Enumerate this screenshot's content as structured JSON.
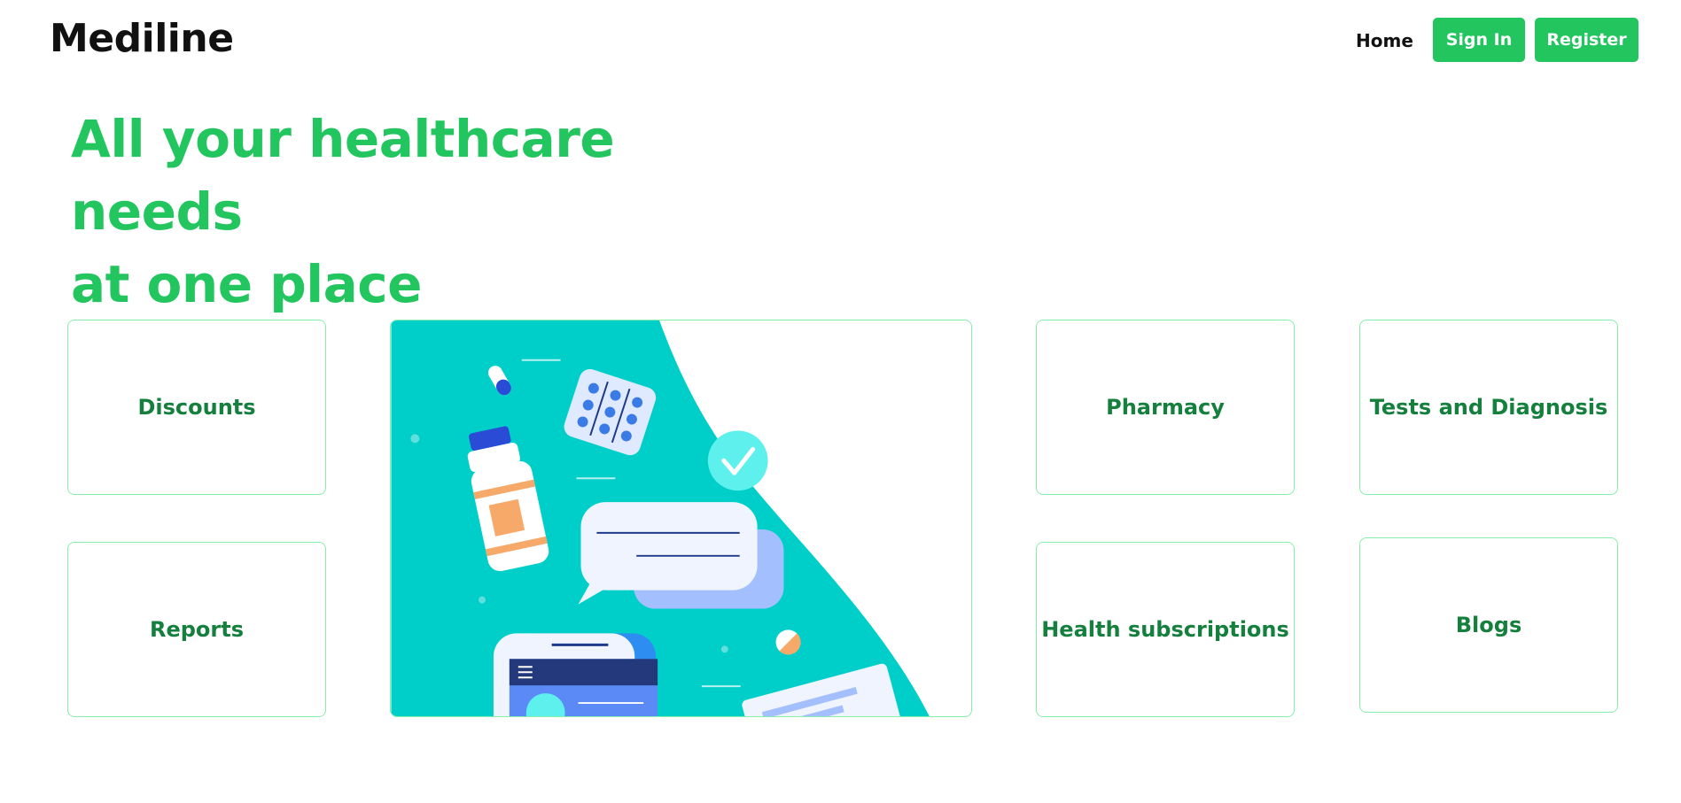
{
  "header": {
    "brand": "Mediline",
    "nav": {
      "home": "Home",
      "sign_in": "Sign In",
      "register": "Register"
    }
  },
  "hero": {
    "title_line1": "All your healthcare needs",
    "title_line2": "at one place"
  },
  "cards": {
    "discounts": "Discounts",
    "reports": "Reports",
    "pharmacy": "Pharmacy",
    "tests": "Tests and Diagnosis",
    "health_subscriptions": "Health subscriptions",
    "blogs": "Blogs"
  },
  "colors": {
    "accent": "#22c55e",
    "card_text": "#15803d",
    "card_border": "#86efac",
    "illustration_bg": "#00cfc9"
  }
}
